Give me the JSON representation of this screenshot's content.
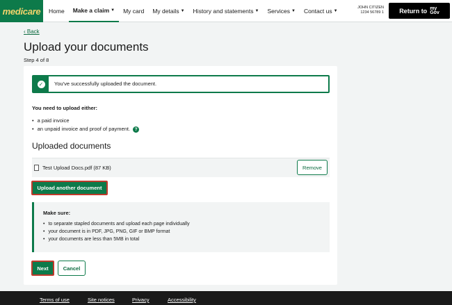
{
  "header": {
    "logo": "medicare",
    "nav": [
      {
        "label": "Home",
        "caret": false
      },
      {
        "label": "Make a claim",
        "caret": true,
        "active": true
      },
      {
        "label": "My card",
        "caret": false
      },
      {
        "label": "My details",
        "caret": true
      },
      {
        "label": "History and statements",
        "caret": true
      },
      {
        "label": "Services",
        "caret": true
      },
      {
        "label": "Contact us",
        "caret": true
      }
    ],
    "user_name": "JOHN CITIZEN",
    "user_number": "1234 56789 1",
    "return_label": "Return to",
    "mygov_top": "my",
    "mygov_bottom": "Gov"
  },
  "page": {
    "back": "Back",
    "title": "Upload your documents",
    "step": "Step 4 of 8"
  },
  "alert": {
    "message": "You've successfully uploaded the document."
  },
  "requirements": {
    "heading": "You need to upload either:",
    "items": [
      "a paid invoice",
      "an unpaid invoice and proof of payment."
    ]
  },
  "uploaded": {
    "heading": "Uploaded documents",
    "file_name": "Test Upload Docs.pdf (87 KB)",
    "remove_label": "Remove",
    "upload_another_label": "Upload another document"
  },
  "make_sure": {
    "heading": "Make sure:",
    "items": [
      "to separate stapled documents and upload each page individually",
      "your document is in PDF, JPG, PNG, GIF or BMP format",
      "your documents are less than 5MB in total"
    ]
  },
  "actions": {
    "next": "Next",
    "cancel": "Cancel"
  },
  "footer": {
    "links": [
      "Terms of use",
      "Site notices",
      "Privacy",
      "Accessibility"
    ]
  },
  "colors": {
    "brand_green": "#0d7a4a",
    "logo_yellow": "#f3d36b",
    "focus_red": "#c0392b"
  }
}
